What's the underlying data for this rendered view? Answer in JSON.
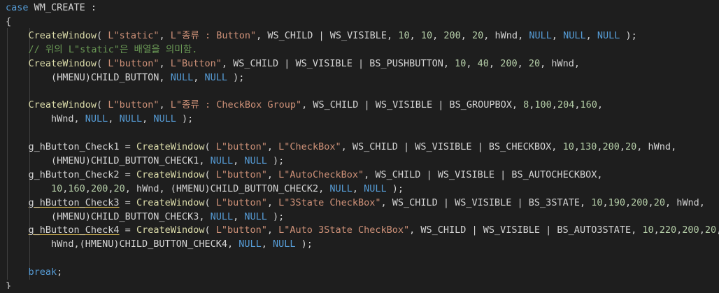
{
  "editor": {
    "colors": {
      "background": "#1e1e1e",
      "keyword": "#569cd6",
      "function": "#dcdcaa",
      "string": "#ce9178",
      "number": "#b5cea8",
      "variable": "#9cdcfe",
      "comment": "#6a9955",
      "text": "#d4d4d4"
    },
    "lines": [
      {
        "indent": 0,
        "tokens": [
          [
            "kw",
            "case"
          ],
          [
            "p",
            " WM_CREATE :"
          ]
        ]
      },
      {
        "indent": 0,
        "tokens": [
          [
            "p",
            "{"
          ]
        ]
      },
      {
        "indent": 1,
        "tokens": [
          [
            "fn",
            "CreateWindow"
          ],
          [
            "p",
            "( "
          ],
          [
            "str",
            "L\"static\""
          ],
          [
            "p",
            ", "
          ],
          [
            "str",
            "L\"종류 : Button\""
          ],
          [
            "p",
            ", WS_CHILD | WS_VISIBLE, "
          ],
          [
            "num",
            "10"
          ],
          [
            "p",
            ", "
          ],
          [
            "num",
            "10"
          ],
          [
            "p",
            ", "
          ],
          [
            "num",
            "200"
          ],
          [
            "p",
            ", "
          ],
          [
            "num",
            "20"
          ],
          [
            "p",
            ", hWnd, "
          ],
          [
            "kw",
            "NULL"
          ],
          [
            "p",
            ", "
          ],
          [
            "kw",
            "NULL"
          ],
          [
            "p",
            ", "
          ],
          [
            "kw",
            "NULL"
          ],
          [
            "p",
            " );"
          ]
        ]
      },
      {
        "indent": 1,
        "tokens": [
          [
            "cmt",
            "// 위의 L\"static\"은 배열을 의미함."
          ]
        ]
      },
      {
        "indent": 1,
        "tokens": [
          [
            "fn",
            "CreateWindow"
          ],
          [
            "p",
            "( "
          ],
          [
            "str",
            "L\"button\""
          ],
          [
            "p",
            ", "
          ],
          [
            "str",
            "L\"Button\""
          ],
          [
            "p",
            ", WS_CHILD | WS_VISIBLE | BS_PUSHBUTTON, "
          ],
          [
            "num",
            "10"
          ],
          [
            "p",
            ", "
          ],
          [
            "num",
            "40"
          ],
          [
            "p",
            ", "
          ],
          [
            "num",
            "200"
          ],
          [
            "p",
            ", "
          ],
          [
            "num",
            "20"
          ],
          [
            "p",
            ", hWnd,"
          ]
        ]
      },
      {
        "indent": 2,
        "tokens": [
          [
            "p",
            "(HMENU)CHILD_BUTTON, "
          ],
          [
            "kw",
            "NULL"
          ],
          [
            "p",
            ", "
          ],
          [
            "kw",
            "NULL"
          ],
          [
            "p",
            " );"
          ]
        ]
      },
      {
        "indent": 0,
        "tokens": []
      },
      {
        "indent": 1,
        "tokens": [
          [
            "fn",
            "CreateWindow"
          ],
          [
            "p",
            "( "
          ],
          [
            "str",
            "L\"button\""
          ],
          [
            "p",
            ", "
          ],
          [
            "str",
            "L\"종류 : CheckBox Group\""
          ],
          [
            "p",
            ", WS_CHILD | WS_VISIBLE | BS_GROUPBOX, "
          ],
          [
            "num",
            "8"
          ],
          [
            "p",
            ","
          ],
          [
            "num",
            "100"
          ],
          [
            "p",
            ","
          ],
          [
            "num",
            "204"
          ],
          [
            "p",
            ","
          ],
          [
            "num",
            "160"
          ],
          [
            "p",
            ","
          ]
        ]
      },
      {
        "indent": 2,
        "tokens": [
          [
            "p",
            "hWnd, "
          ],
          [
            "kw",
            "NULL"
          ],
          [
            "p",
            ", "
          ],
          [
            "kw",
            "NULL"
          ],
          [
            "p",
            ", "
          ],
          [
            "kw",
            "NULL"
          ],
          [
            "p",
            " );"
          ]
        ]
      },
      {
        "indent": 0,
        "tokens": []
      },
      {
        "indent": 1,
        "tokens": [
          [
            "p",
            "g_hButton_Check1 = "
          ],
          [
            "fn",
            "CreateWindow"
          ],
          [
            "p",
            "( "
          ],
          [
            "str",
            "L\"button\""
          ],
          [
            "p",
            ", "
          ],
          [
            "str",
            "L\"CheckBox\""
          ],
          [
            "p",
            ", WS_CHILD | WS_VISIBLE | BS_CHECKBOX, "
          ],
          [
            "num",
            "10"
          ],
          [
            "p",
            ","
          ],
          [
            "num",
            "130"
          ],
          [
            "p",
            ","
          ],
          [
            "num",
            "200"
          ],
          [
            "p",
            ","
          ],
          [
            "num",
            "20"
          ],
          [
            "p",
            ", hWnd,"
          ]
        ]
      },
      {
        "indent": 2,
        "tokens": [
          [
            "p",
            "(HMENU)CHILD_BUTTON_CHECK1, "
          ],
          [
            "kw",
            "NULL"
          ],
          [
            "p",
            ", "
          ],
          [
            "kw",
            "NULL"
          ],
          [
            "p",
            " );"
          ]
        ]
      },
      {
        "indent": 1,
        "tokens": [
          [
            "p",
            "g_hButton_Check2 = "
          ],
          [
            "fn",
            "CreateWindow"
          ],
          [
            "p",
            "( "
          ],
          [
            "str",
            "L\"button\""
          ],
          [
            "p",
            ", "
          ],
          [
            "str",
            "L\"AutoCheckBox\""
          ],
          [
            "p",
            ", WS_CHILD | WS_VISIBLE | BS_AUTOCHECKBOX,"
          ]
        ]
      },
      {
        "indent": 2,
        "tokens": [
          [
            "num",
            "10"
          ],
          [
            "p",
            ","
          ],
          [
            "num",
            "160"
          ],
          [
            "p",
            ","
          ],
          [
            "num",
            "200"
          ],
          [
            "p",
            ","
          ],
          [
            "num",
            "20"
          ],
          [
            "p",
            ", hWnd, (HMENU)CHILD_BUTTON_CHECK2, "
          ],
          [
            "kw",
            "NULL"
          ],
          [
            "p",
            ", "
          ],
          [
            "kw",
            "NULL"
          ],
          [
            "p",
            " );"
          ]
        ]
      },
      {
        "indent": 1,
        "tokens": [
          [
            "pu",
            "g_hButton_Check3"
          ],
          [
            "p",
            " = "
          ],
          [
            "fn",
            "CreateWindow"
          ],
          [
            "p",
            "( "
          ],
          [
            "str",
            "L\"button\""
          ],
          [
            "p",
            ", "
          ],
          [
            "str",
            "L\"3State CheckBox\""
          ],
          [
            "p",
            ", WS_CHILD | WS_VISIBLE | BS_3STATE, "
          ],
          [
            "num",
            "10"
          ],
          [
            "p",
            ","
          ],
          [
            "num",
            "190"
          ],
          [
            "p",
            ","
          ],
          [
            "num",
            "200"
          ],
          [
            "p",
            ","
          ],
          [
            "num",
            "20"
          ],
          [
            "p",
            ", hWnd,"
          ]
        ]
      },
      {
        "indent": 2,
        "tokens": [
          [
            "p",
            "(HMENU)CHILD_BUTTON_CHECK3, "
          ],
          [
            "kw",
            "NULL"
          ],
          [
            "p",
            ", "
          ],
          [
            "kw",
            "NULL"
          ],
          [
            "p",
            " );"
          ]
        ]
      },
      {
        "indent": 1,
        "tokens": [
          [
            "pu",
            "g_hButton_Check4"
          ],
          [
            "p",
            " = "
          ],
          [
            "fn",
            "CreateWindow"
          ],
          [
            "p",
            "( "
          ],
          [
            "str",
            "L\"button\""
          ],
          [
            "p",
            ", "
          ],
          [
            "str",
            "L\"Auto 3State CheckBox\""
          ],
          [
            "p",
            ", WS_CHILD | WS_VISIBLE | BS_AUTO3STATE, "
          ],
          [
            "num",
            "10"
          ],
          [
            "p",
            ","
          ],
          [
            "num",
            "220"
          ],
          [
            "p",
            ","
          ],
          [
            "num",
            "200"
          ],
          [
            "p",
            ","
          ],
          [
            "num",
            "20"
          ],
          [
            "p",
            ","
          ]
        ]
      },
      {
        "indent": 2,
        "tokens": [
          [
            "p",
            "hWnd,(HMENU)CHILD_BUTTON_CHECK4, "
          ],
          [
            "kw",
            "NULL"
          ],
          [
            "p",
            ", "
          ],
          [
            "kw",
            "NULL"
          ],
          [
            "p",
            " );"
          ]
        ]
      },
      {
        "indent": 0,
        "tokens": []
      },
      {
        "indent": 1,
        "tokens": [
          [
            "kw",
            "break"
          ],
          [
            "p",
            ";"
          ]
        ]
      },
      {
        "indent": 0,
        "tokens": [
          [
            "p",
            "}"
          ]
        ]
      }
    ]
  }
}
